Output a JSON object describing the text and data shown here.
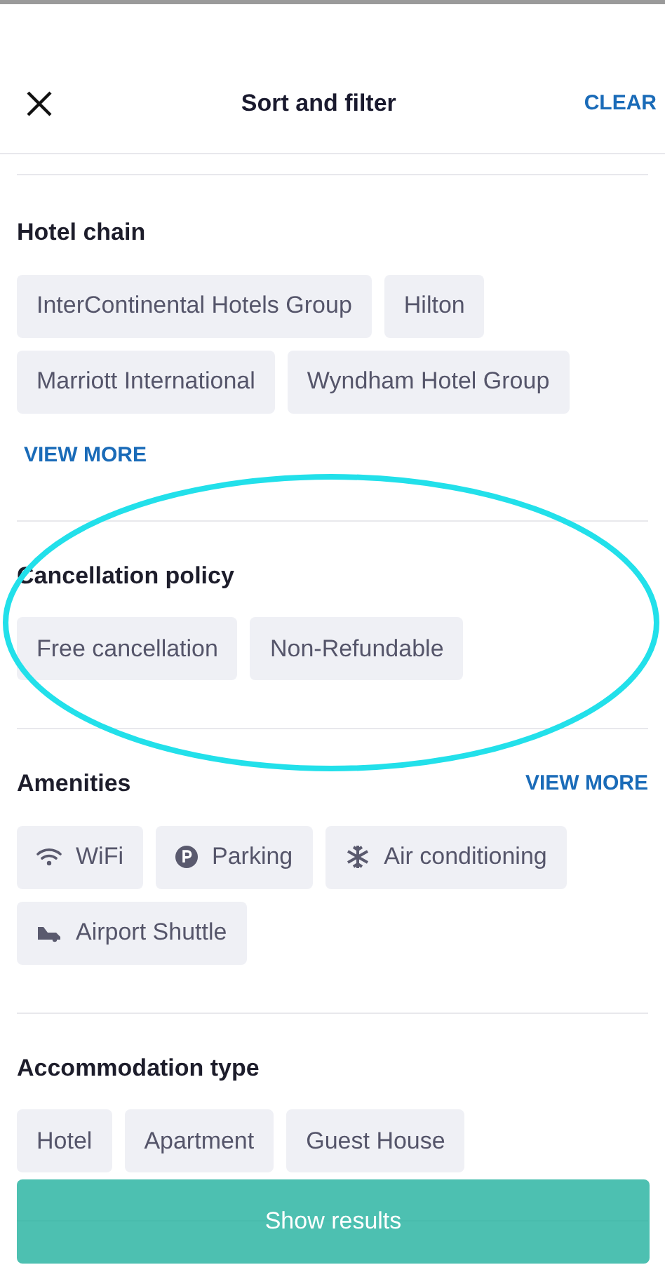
{
  "header": {
    "title": "Sort and filter",
    "clear": "CLEAR"
  },
  "sections": [
    {
      "title": "Hotel chain",
      "chips": [
        "InterContinental Hotels Group",
        "Hilton",
        "Marriott International",
        "Wyndham Hotel Group"
      ],
      "more": "VIEW MORE",
      "kind": "more_below"
    },
    {
      "title": "Cancellation policy",
      "chips": [
        "Free cancellation",
        "Non-Refundable"
      ]
    },
    {
      "title": "Amenities",
      "chips": [
        "WiFi",
        "Parking",
        "Air conditioning",
        "Airport Shuttle"
      ],
      "more": "VIEW MORE",
      "kind": "icons_more_right"
    },
    {
      "title": "Accommodation type",
      "chips": [
        "Hotel",
        "Apartment",
        "Guest House"
      ]
    }
  ],
  "button": {
    "label": "Show results"
  }
}
